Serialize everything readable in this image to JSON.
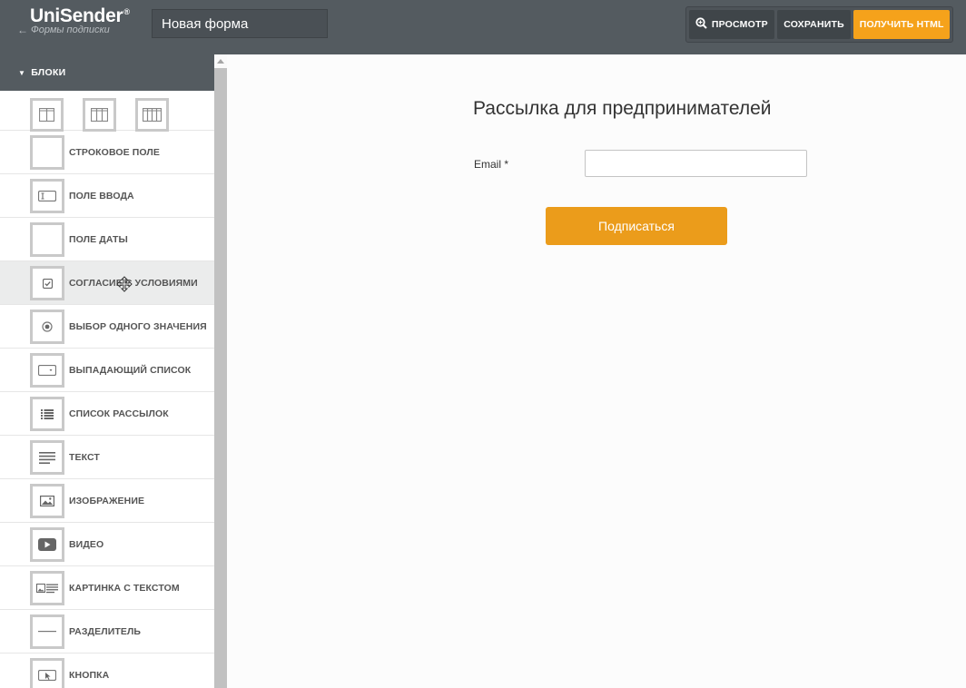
{
  "header": {
    "logo": "UniSender",
    "logo_mark": "®",
    "back_link": "Формы подписки",
    "back_icon": "arrow-left-icon",
    "form_name": "Новая форма",
    "buttons": {
      "preview": "ПРОСМОТР",
      "save": "СОХРАНИТЬ",
      "get_html": "ПОЛУЧИТЬ HTML"
    },
    "accent_color": "#f5a21b"
  },
  "sidebar": {
    "title": "БЛОКИ",
    "column_layouts": [
      "2-columns-icon",
      "3-columns-icon",
      "4-columns-icon"
    ],
    "items": [
      {
        "label": "СТРОКОВОЕ ПОЛЕ",
        "icon": "blank-icon"
      },
      {
        "label": "ПОЛЕ ВВОДА",
        "icon": "input-field-icon"
      },
      {
        "label": "ПОЛЕ ДАТЫ",
        "icon": "blank-icon"
      },
      {
        "label": "СОГЛАСИЕ С УСЛОВИЯМИ",
        "icon": "checkbox-icon",
        "active": true
      },
      {
        "label": "ВЫБОР ОДНОГО ЗНАЧЕНИЯ",
        "icon": "radio-icon"
      },
      {
        "label": "ВЫПАДАЮЩИЙ СПИСОК",
        "icon": "dropdown-icon"
      },
      {
        "label": "СПИСОК РАССЫЛОК",
        "icon": "list-icon"
      },
      {
        "label": "ТЕКСТ",
        "icon": "text-lines-icon"
      },
      {
        "label": "ИЗОБРАЖЕНИЕ",
        "icon": "image-icon"
      },
      {
        "label": "ВИДЕО",
        "icon": "video-icon"
      },
      {
        "label": "КАРТИНКА С ТЕКСТОМ",
        "icon": "image-text-icon"
      },
      {
        "label": "РАЗДЕЛИТЕЛЬ",
        "icon": "divider-icon"
      },
      {
        "label": "КНОПКА",
        "icon": "button-icon"
      }
    ]
  },
  "form": {
    "title": "Рассылка для предпринимателей",
    "email_label": "Email *",
    "email_value": "",
    "submit_label": "Подписаться",
    "button_color": "#eb9c1b"
  }
}
